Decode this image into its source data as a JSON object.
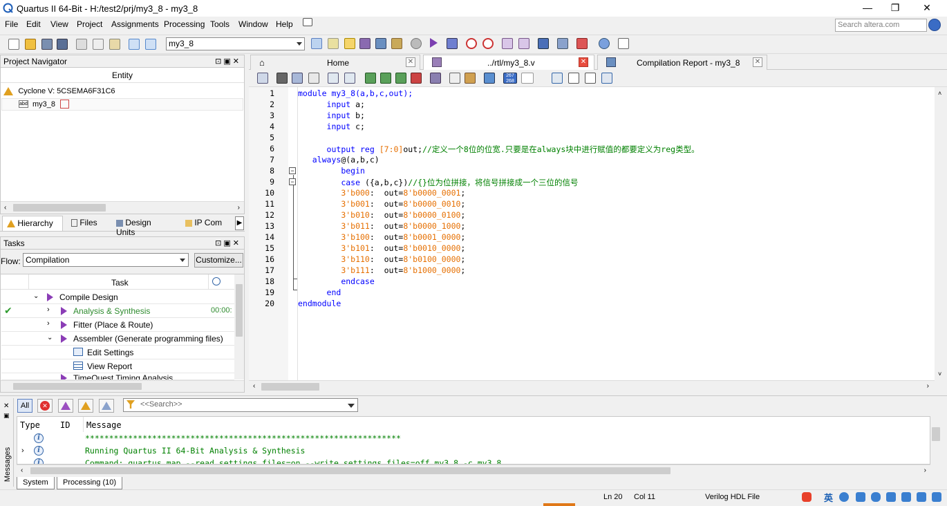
{
  "window": {
    "title": "Quartus II 64-Bit - H:/test2/prj/my3_8 - my3_8",
    "minimize": "—",
    "maximize": "❐",
    "close": "✕"
  },
  "menu": [
    "File",
    "Edit",
    "View",
    "Project",
    "Assignments",
    "Processing",
    "Tools",
    "Window",
    "Help"
  ],
  "search": {
    "placeholder": "Search altera.com"
  },
  "toolbar": {
    "entity_value": "my3_8"
  },
  "project_navigator": {
    "title": "Project Navigator",
    "column": "Entity",
    "device": "Cyclone V: 5CSEMA6F31C6",
    "entity": "my3_8",
    "tabs": [
      "Hierarchy",
      "Files",
      "Design Units",
      "IP Com"
    ]
  },
  "tasks": {
    "title": "Tasks",
    "flow_label": "Flow:",
    "flow_value": "Compilation",
    "customize": "Customize...",
    "col_task": "Task",
    "rows": [
      {
        "label": "Compile Design",
        "time": ""
      },
      {
        "label": "Analysis & Synthesis",
        "time": "00:00:"
      },
      {
        "label": "Fitter (Place & Route)",
        "time": ""
      },
      {
        "label": "Assembler (Generate programming files)",
        "time": ""
      },
      {
        "label": "Edit Settings",
        "time": ""
      },
      {
        "label": "View Report",
        "time": ""
      },
      {
        "label": "TimeQuest Timing Analysis",
        "time": ""
      }
    ]
  },
  "editor": {
    "tabs": [
      {
        "label": "Home"
      },
      {
        "label": "../rtl/my3_8.v"
      },
      {
        "label": "Compilation Report - my3_8"
      }
    ],
    "line_numbers": [
      "1",
      "2",
      "3",
      "4",
      "5",
      "6",
      "7",
      "8",
      "9",
      "10",
      "11",
      "12",
      "13",
      "14",
      "15",
      "16",
      "17",
      "18",
      "19",
      "20"
    ],
    "lines": {
      "l1": "module my3_8(a,b,c,out);",
      "l2_kw": "input",
      "l2_rest": " a;",
      "l3_kw": "input",
      "l3_rest": " b;",
      "l4_kw": "input",
      "l4_rest": " c;",
      "l6_kw": "output reg",
      "l6_num": "[7:0]",
      "l6_mid": "out;",
      "l6_cm": "//定义一个8位的位宽.只要是在always块中进行赋值的都要定义为reg类型。",
      "l7_kw": "always",
      "l7_rest": "@(a,b,c)",
      "l8_kw": "begin",
      "l9_kw": "case",
      "l9_rest": " ({a,b,c})",
      "l9_cm": "//{}位为位拼接，将信号拼接成一个三位的信号",
      "cases": [
        {
          "sel": "3'b000",
          "val": "8'b0000_0001"
        },
        {
          "sel": "3'b001",
          "val": "8'b0000_0010"
        },
        {
          "sel": "3'b010",
          "val": "8'b0000_0100"
        },
        {
          "sel": "3'b011",
          "val": "8'b0000_1000"
        },
        {
          "sel": "3'b100",
          "val": "8'b0001_0000"
        },
        {
          "sel": "3'b101",
          "val": "8'b0010_0000"
        },
        {
          "sel": "3'b110",
          "val": "8'b0100_0000"
        },
        {
          "sel": "3'b111",
          "val": "8'b1000_0000"
        }
      ],
      "case_mid": ":  out=",
      "semi": ";",
      "l18_kw": "endcase",
      "l19_kw": "end",
      "l20_kw": "endmodule"
    }
  },
  "messages": {
    "side_label": "Messages",
    "filter_all": "All",
    "search_placeholder": "<<Search>>",
    "col_type": "Type",
    "col_id": "ID",
    "col_message": "Message",
    "rows": [
      "******************************************************************",
      "Running Quartus II 64-Bit Analysis & Synthesis",
      "Command: quartus_map --read_settings_files=on --write_settings_files=off my3_8 -c my3_8"
    ],
    "tabs": [
      "System",
      "Processing (10)"
    ]
  },
  "status": {
    "ln": "Ln 20",
    "col": "Col 11",
    "lang": "Verilog HDL File",
    "ime": "英"
  }
}
